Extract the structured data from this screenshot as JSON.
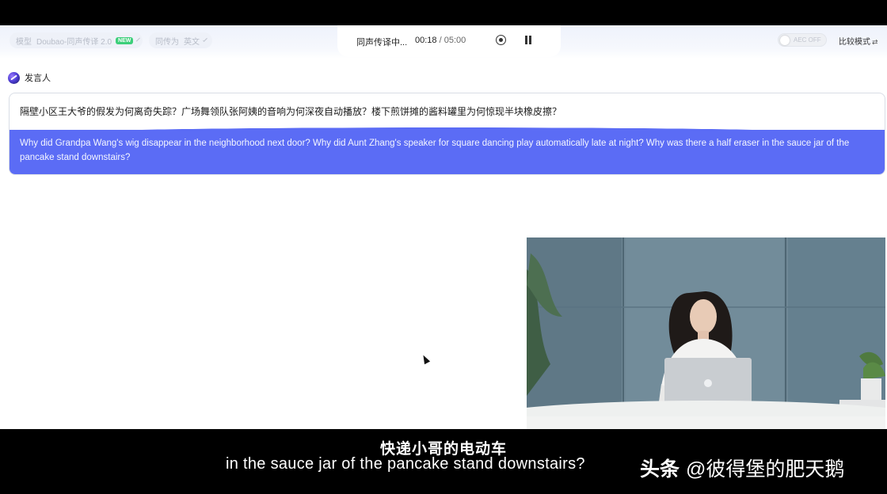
{
  "toolbar": {
    "model_label": "模型",
    "model_value": "Doubao-同声传译 2.0",
    "model_badge": "NEW",
    "target_label": "同传为",
    "target_value": "英文",
    "status_text": "同声传译中...",
    "elapsed_time": "00:18",
    "time_separator": " / ",
    "total_time": "05:00",
    "aec_label": "AEC OFF",
    "compare_mode_label": "比较模式",
    "compare_mode_icon": "⇄"
  },
  "speaker": {
    "name": "发言人"
  },
  "transcript": {
    "source_text": "隔壁小区王大爷的假发为何离奇失踪？广场舞领队张阿姨的音响为何深夜自动播放？楼下煎饼摊的酱料罐里为何惊现半块橡皮擦？",
    "translation_text": "Why did Grandpa Wang's wig disappear in the neighborhood next door? Why did Aunt Zhang's speaker for square dancing play automatically late at night? Why was there a half eraser in the sauce jar of the pancake stand downstairs?"
  },
  "subtitles": {
    "chinese": "快递小哥的电动车",
    "english": "in the sauce jar of the pancake stand downstairs?"
  },
  "watermark": {
    "brand": "头条",
    "handle": "@彼得堡的肥天鹅"
  },
  "colors": {
    "accent": "#5b6cf5",
    "badge_green": "#3ccf7a"
  }
}
